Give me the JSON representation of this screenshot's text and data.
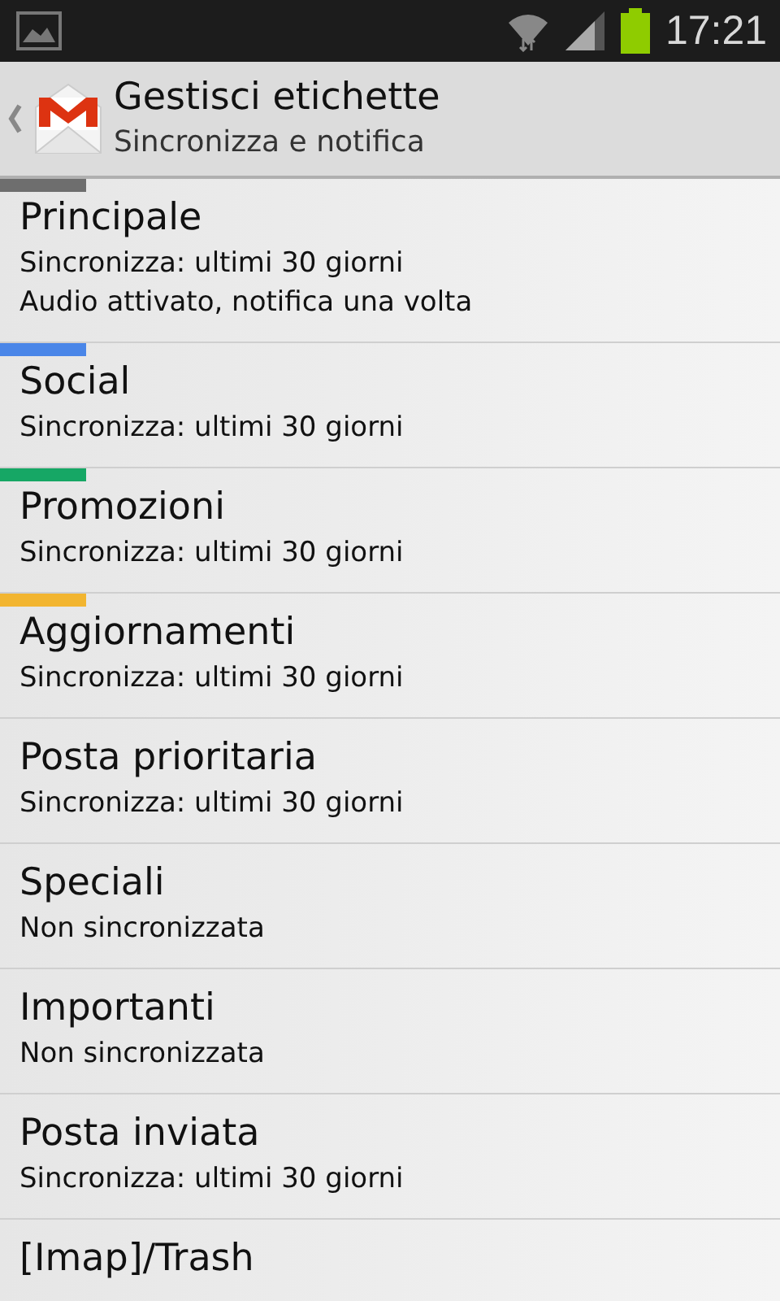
{
  "status_bar": {
    "time": "17:21"
  },
  "header": {
    "title": "Gestisci etichette",
    "subtitle": "Sincronizza e notifica"
  },
  "labels": [
    {
      "name": "Principale",
      "lines": [
        "Sincronizza: ultimi 30 giorni",
        "Audio attivato, notifica una volta"
      ],
      "color": "#6e6e6e"
    },
    {
      "name": "Social",
      "lines": [
        "Sincronizza: ultimi 30 giorni"
      ],
      "color": "#4a86e8"
    },
    {
      "name": "Promozioni",
      "lines": [
        "Sincronizza: ultimi 30 giorni"
      ],
      "color": "#16a765"
    },
    {
      "name": "Aggiornamenti",
      "lines": [
        "Sincronizza: ultimi 30 giorni"
      ],
      "color": "#f2b530"
    },
    {
      "name": "Posta prioritaria",
      "lines": [
        "Sincronizza: ultimi 30 giorni"
      ]
    },
    {
      "name": "Speciali",
      "lines": [
        "Non sincronizzata"
      ]
    },
    {
      "name": "Importanti",
      "lines": [
        "Non sincronizzata"
      ]
    },
    {
      "name": "Posta inviata",
      "lines": [
        "Sincronizza: ultimi 30 giorni"
      ]
    },
    {
      "name": "[Imap]/Trash"
    }
  ]
}
